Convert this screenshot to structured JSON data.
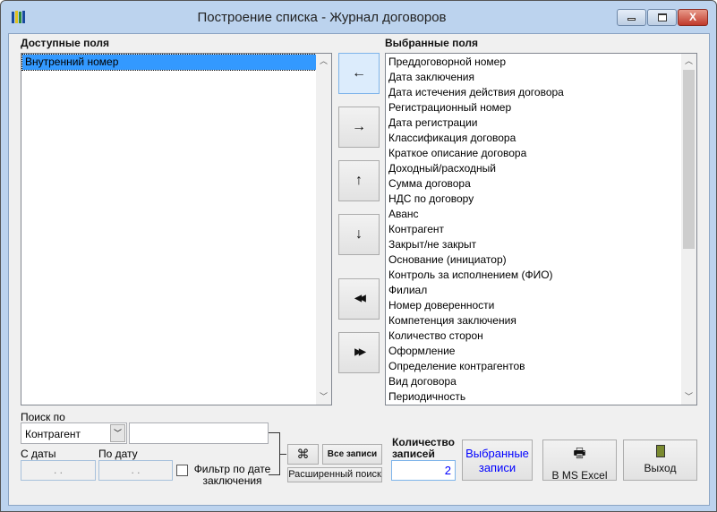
{
  "window": {
    "title": "Построение списка - Журнал договоров"
  },
  "available": {
    "label": "Доступные поля",
    "items": [
      "Внутренний номер"
    ]
  },
  "selected": {
    "label": "Выбранные поля",
    "items": [
      "Преддоговорной номер",
      "Дата заключения",
      "Дата истечения действия договора",
      "Регистрационный номер",
      "Дата регистрации",
      "Классификация договора",
      "Краткое описание договора",
      "Доходный/расходный",
      "Сумма договора",
      "НДС по договору",
      "Аванс",
      "Контрагент",
      "Закрыт/не закрыт",
      "Основание (инициатор)",
      "Контроль за исполнением (ФИО)",
      "Филиал",
      "Номер доверенности",
      "Компетенция заключения",
      "Количество сторон",
      "Оформление",
      "Определение контрагентов",
      "Вид договора",
      "Периодичность"
    ]
  },
  "move_buttons": {
    "left": "←",
    "right": "→",
    "up": "↑",
    "down": "↓",
    "all_left": "◀◀",
    "all_right": "▶▶"
  },
  "search": {
    "label": "Поиск по",
    "field": "Контрагент",
    "value": "",
    "from_label": "С даты",
    "to_label": "По дату",
    "from_value": ". .",
    "to_value": ". .",
    "filter_label": "Фильтр по дате заключения",
    "filter_checked": false,
    "all_records": "Все записи",
    "advanced": "Расширенный поиск"
  },
  "count": {
    "label": "Количество записей",
    "value": "2"
  },
  "actions": {
    "selected_records": "Выбранные записи",
    "excel": "В MS Excel",
    "exit": "Выход"
  }
}
